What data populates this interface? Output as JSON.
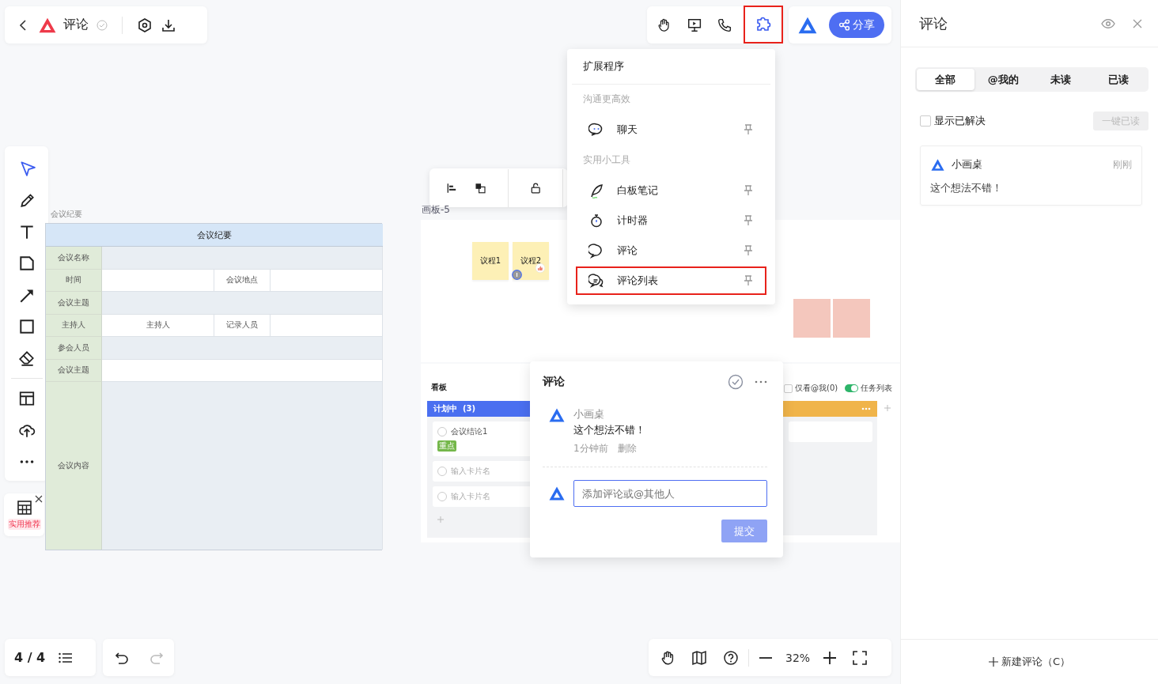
{
  "header": {
    "title": "评论"
  },
  "share_button": "分享",
  "extensions_menu": {
    "title": "扩展程序",
    "sections": [
      {
        "heading": "沟通更高效",
        "items": [
          {
            "label": "聊天",
            "highlighted": false
          }
        ]
      },
      {
        "heading": "实用小工具",
        "items": [
          {
            "label": "白板笔记",
            "highlighted": false
          },
          {
            "label": "计时器",
            "highlighted": false
          },
          {
            "label": "评论",
            "highlighted": false
          },
          {
            "label": "评论列表",
            "highlighted": true
          }
        ]
      }
    ]
  },
  "left_toolbar": {
    "tools": [
      {
        "selected": true
      },
      {
        "selected": false
      },
      {
        "selected": false
      },
      {
        "selected": false
      },
      {
        "selected": false
      },
      {
        "selected": false
      },
      {
        "selected": false
      },
      {
        "selected": false
      },
      {
        "selected": false
      },
      {
        "selected": false
      }
    ]
  },
  "recommend_card": {
    "label": "实用推荐"
  },
  "minutes_table": {
    "caption": "会议纪要",
    "title": "会议纪要",
    "rows": [
      {
        "label": "会议名称",
        "kind": "full"
      },
      {
        "label": "时间",
        "kind": "split",
        "middle_label": "会议地点"
      },
      {
        "label": "会议主题",
        "kind": "full"
      },
      {
        "label": "主持人",
        "kind": "split",
        "value": "主持人",
        "middle_label": "记录人员"
      },
      {
        "label": "参会人员",
        "kind": "full"
      },
      {
        "label": "会议主题",
        "kind": "full"
      },
      {
        "label": "会议内容",
        "kind": "full"
      }
    ]
  },
  "frame": {
    "label": "画板-5",
    "stickies": [
      {
        "text": "议程1"
      },
      {
        "text": "议程2"
      }
    ]
  },
  "kanban": {
    "title": "看板",
    "filter": {
      "label": "仅看@我(0)",
      "checked": false
    },
    "toggle": {
      "label": "任务列表",
      "on": true
    },
    "columns": [
      {
        "name": "计划中",
        "count": "(3)",
        "color": "#4a6ff0",
        "cards": [
          {
            "kind": "task",
            "checked": false,
            "text": "会议结论1",
            "tag": "重点"
          },
          {
            "kind": "task",
            "checked": false,
            "placeholder": "输入卡片名"
          },
          {
            "kind": "task",
            "checked": false,
            "placeholder": "输入卡片名"
          }
        ]
      },
      {
        "color": "#f0b44a",
        "cards": [
          {
            "kind": "covered"
          }
        ]
      }
    ]
  },
  "comment_popup": {
    "title": "评论",
    "author": "小画桌",
    "text": "这个想法不错！",
    "time": "1分钟前",
    "delete": "删除",
    "placeholder": "添加评论或@其他人",
    "submit": "提交",
    "submit_disabled": true
  },
  "page_counter": "4 / 4",
  "zoom": "32%",
  "comments_panel": {
    "title": "评论",
    "tabs": [
      {
        "label": "全部",
        "selected": true
      },
      {
        "label": "@我的",
        "selected": false
      },
      {
        "label": "未读",
        "selected": false
      },
      {
        "label": "已读",
        "selected": false
      }
    ],
    "show_resolved": {
      "label": "显示已解决",
      "checked": false
    },
    "mark_all_read": "一键已读",
    "comments": [
      {
        "author": "小画桌",
        "time": "刚刚",
        "text": "这个想法不错！"
      }
    ],
    "new_comment": "新建评论（C）"
  }
}
